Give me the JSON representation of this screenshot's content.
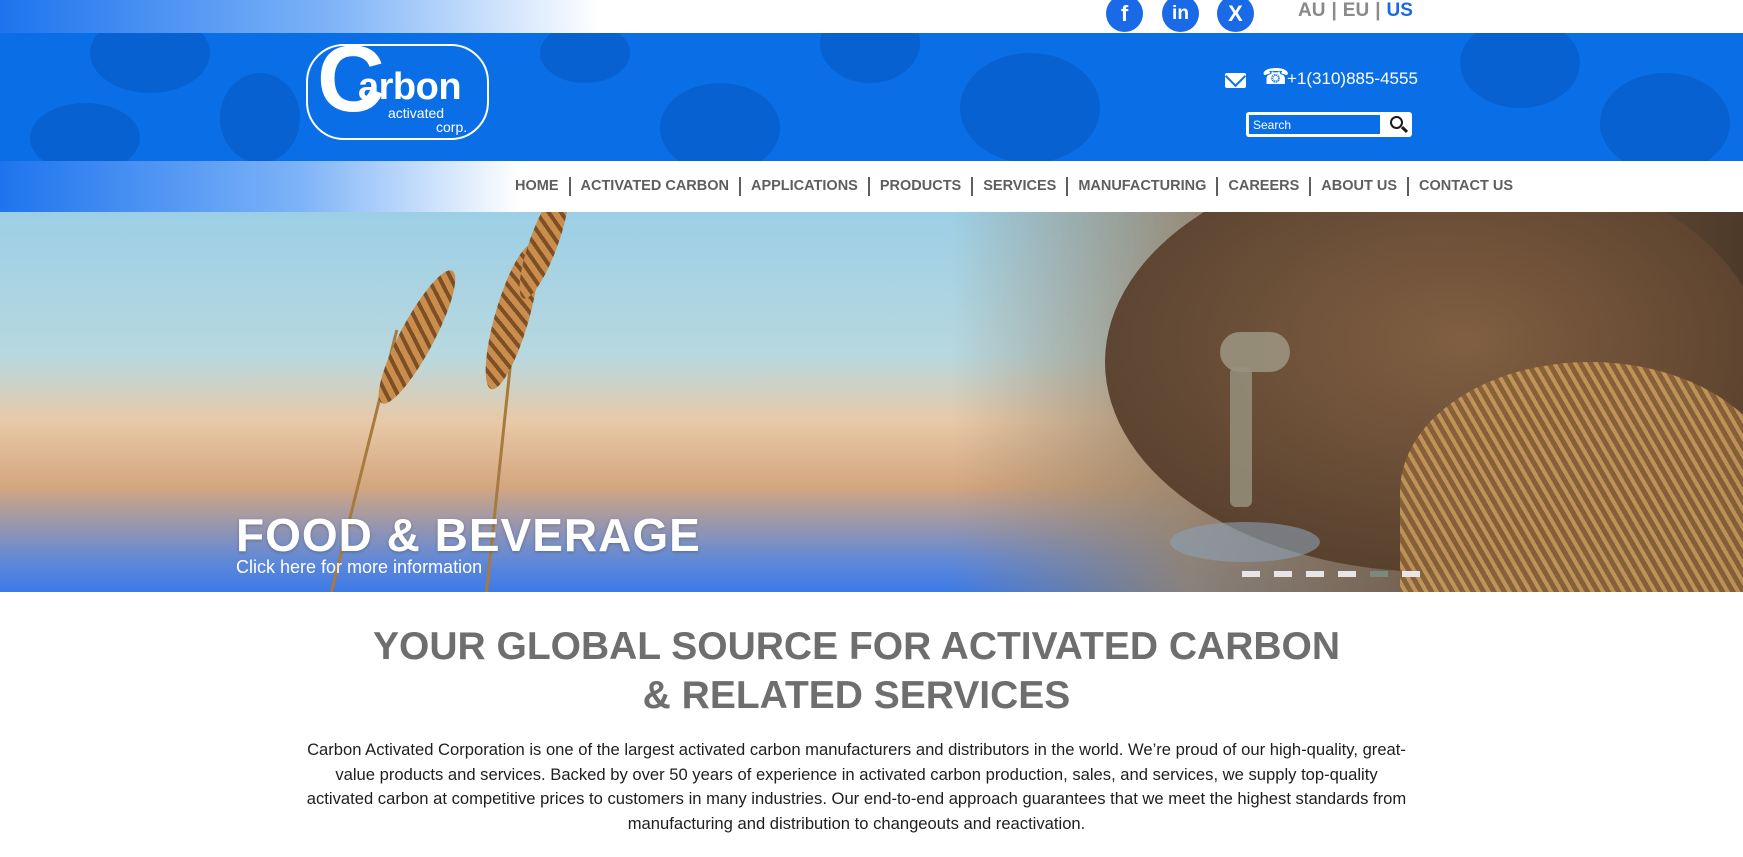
{
  "social": {
    "facebook": "f",
    "linkedin": "in",
    "twitter": "X"
  },
  "regions": {
    "au": "AU",
    "eu": "EU",
    "us": "US",
    "separator": "|"
  },
  "header": {
    "logo_letter": "C",
    "logo_word": "arbon",
    "logo_line1": "activated",
    "logo_line2": "corp.",
    "phone": "+1(310)885-4555",
    "search_placeholder": "Search"
  },
  "nav": {
    "items": [
      {
        "label": "HOME"
      },
      {
        "label": "ACTIVATED CARBON"
      },
      {
        "label": "APPLICATIONS"
      },
      {
        "label": "PRODUCTS"
      },
      {
        "label": "SERVICES"
      },
      {
        "label": "MANUFACTURING"
      },
      {
        "label": "CAREERS"
      },
      {
        "label": "ABOUT US"
      },
      {
        "label": "CONTACT US"
      }
    ]
  },
  "hero": {
    "title": "FOOD & BEVERAGE",
    "subtitle": "Click here for more information",
    "slide_count": 6,
    "active_slide": 5
  },
  "content": {
    "headline_line1": "YOUR GLOBAL SOURCE FOR ACTIVATED CARBON",
    "headline_line2": "& RELATED SERVICES",
    "intro": "Carbon Activated Corporation is one of the largest activated carbon manufacturers and distributors in the world. We’re proud of our high-quality, great-value products and services.  Backed by over 50 years of experience in activated carbon production, sales, and services, we supply top-quality activated carbon at competitive prices to customers in many industries. Our end-to-end approach guarantees that we meet the highest standards from manufacturing and distribution to changeouts and reactivation."
  },
  "icons": {
    "mail": "envelope-icon",
    "phone": "phone-icon",
    "search": "magnifier-icon"
  },
  "colors": {
    "brand_blue": "#0a6fe6",
    "nav_text": "#5e5e5e",
    "headline_gray": "#6e6e6e",
    "active_region": "#1a6ae8"
  }
}
